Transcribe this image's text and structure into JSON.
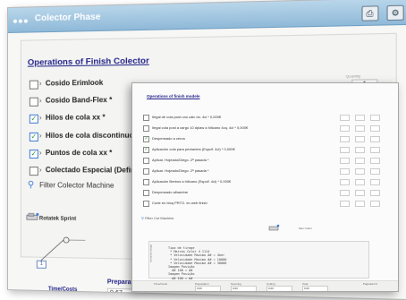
{
  "back_window": {
    "title": "Colector Phase",
    "section_title": "Operations of Finish Colector",
    "quantity": {
      "label": "Quantity",
      "value": "1"
    },
    "options": [
      {
        "label": "Cosido Erimlook",
        "checked": false
      },
      {
        "label": "Cosido Band-Flex *",
        "checked": false
      },
      {
        "label": "Hilos de cola xx *",
        "checked": true
      },
      {
        "label": "Hilos de cola discontinuos",
        "checked": true
      },
      {
        "label": "Puntos de cola xx *",
        "checked": true
      },
      {
        "label": "Colectado Especial (Define",
        "checked": false
      }
    ],
    "filter_label": "Filter Colector Machine",
    "machine_name": "Rotatek Sprint",
    "diagram_value": "1",
    "time_label": "Time/Costs",
    "preparation_label": "Preparation",
    "preparation_value": "0,67"
  },
  "front_window": {
    "title": "Operations of finish modele",
    "rows": [
      {
        "label": "Ilegal de cola post uno calc du. 4cl *  0,000€",
        "checked": false
      },
      {
        "label": "Ilegal cola post a cargo 10 dpiaw a hilicano 4cq. 4cl *  0,000€",
        "checked": false
      },
      {
        "label": "Despensado a cerca",
        "checked": true
      },
      {
        "label": "Aplicación cola para pedrantes (Espcif. 4cl) *  0,000€",
        "checked": true
      },
      {
        "label": "Aplicar. Hojeado/Diego. 2ª pasada *",
        "checked": false
      },
      {
        "label": "Aplicar. Hojeado/Diego. 2ª pasada *",
        "checked": false
      },
      {
        "label": "Aplicación Bretros a hilicano (Espcif. 4cl) *  0,000€",
        "checked": false
      },
      {
        "label": "Despensado alhambre",
        "checked": false
      },
      {
        "label": "Corte en bloq PRTO. en web finish",
        "checked": false
      }
    ],
    "filter_label": "Filter Cut Machine",
    "machine_name": "Man Cutter",
    "notes": "Tipo de tirage\n * Marcos Color 4 1114\n * Velocidade Maximo ## = 4ker\n * Velocidade Maximo ## = 10000\n * Velocidade Maximo ## = 30000\nImagem Posição\n  ## 100 = ##\nImagem Posição\n  ## 100 = ##",
    "side_label": "Observaciones",
    "bottom_labels": [
      "Time/Costs",
      "Preparation",
      "Sourcing",
      "Cutting",
      "Total",
      "Paginado Fl"
    ],
    "bottom_values": [
      "",
      "0,00",
      "0,00",
      "0,00",
      "0,00",
      ""
    ]
  },
  "colors": {
    "titlebar": "#8fb9d8",
    "link_blue": "#23238a",
    "check_green": "#2a8a2a"
  }
}
